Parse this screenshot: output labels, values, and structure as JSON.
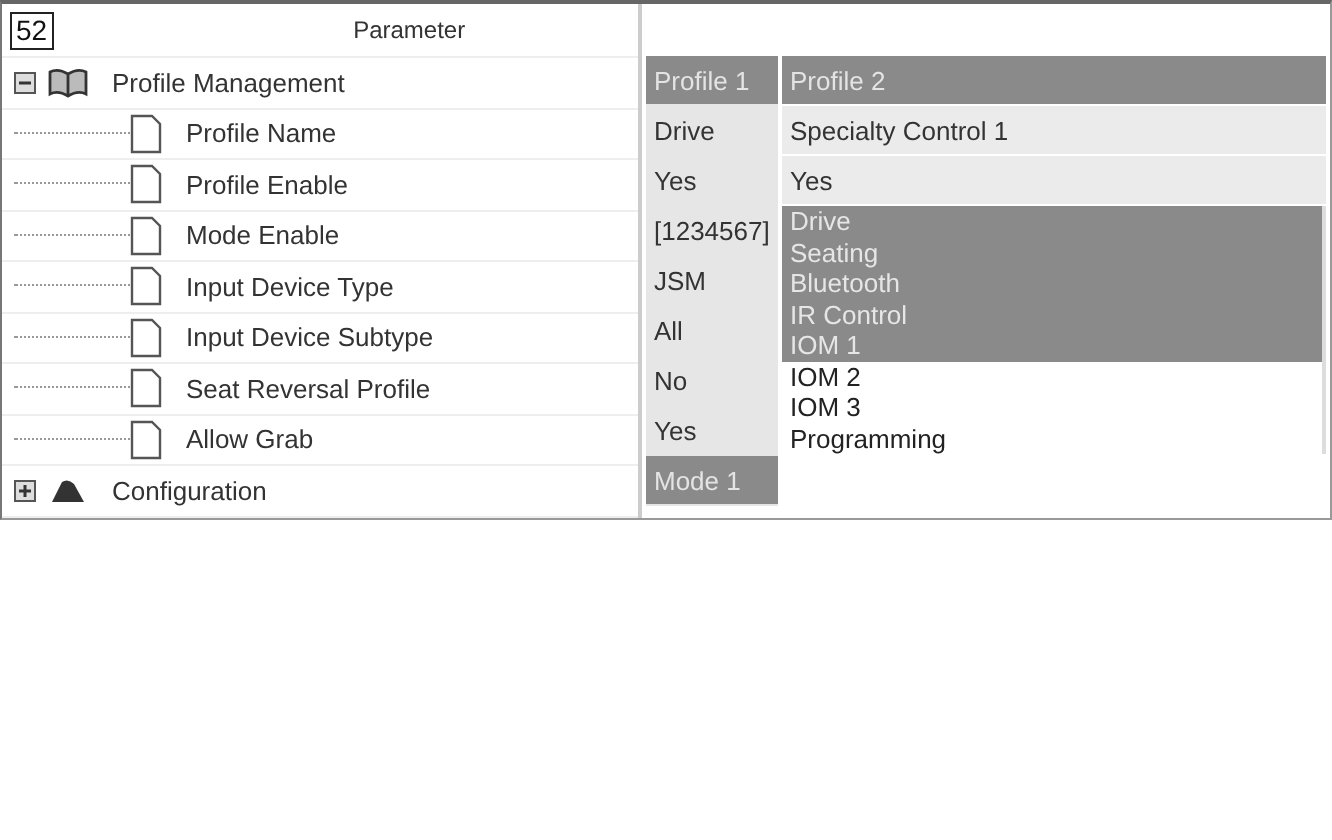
{
  "figure_number": "52",
  "tree": {
    "header": "Parameter",
    "nodes": [
      {
        "label": "Profile Management",
        "kind": "book",
        "expanded": true,
        "children": [
          {
            "label": "Profile Name"
          },
          {
            "label": "Profile Enable"
          },
          {
            "label": "Mode Enable"
          },
          {
            "label": "Input Device Type"
          },
          {
            "label": "Input Device Subtype"
          },
          {
            "label": "Seat Reversal Profile"
          },
          {
            "label": "Allow Grab"
          }
        ]
      },
      {
        "label": "Configuration",
        "kind": "category",
        "expanded": false
      }
    ]
  },
  "columns": [
    {
      "header": "Profile 1",
      "cells": [
        "Drive",
        "Yes",
        "[1234567]",
        "JSM",
        "All",
        "No",
        "Yes"
      ],
      "group_cell": "Mode 1"
    },
    {
      "header": "Profile 2",
      "cells": [
        "Specialty Control 1",
        "Yes"
      ],
      "mode_list": [
        {
          "label": "Drive",
          "selected": true
        },
        {
          "label": "Seating",
          "selected": true
        },
        {
          "label": "Bluetooth",
          "selected": true
        },
        {
          "label": "IR Control",
          "selected": true
        },
        {
          "label": "IOM 1",
          "selected": true
        },
        {
          "label": "IOM 2",
          "selected": false
        },
        {
          "label": "IOM 3",
          "selected": false
        },
        {
          "label": "Programming",
          "selected": false
        }
      ]
    }
  ]
}
